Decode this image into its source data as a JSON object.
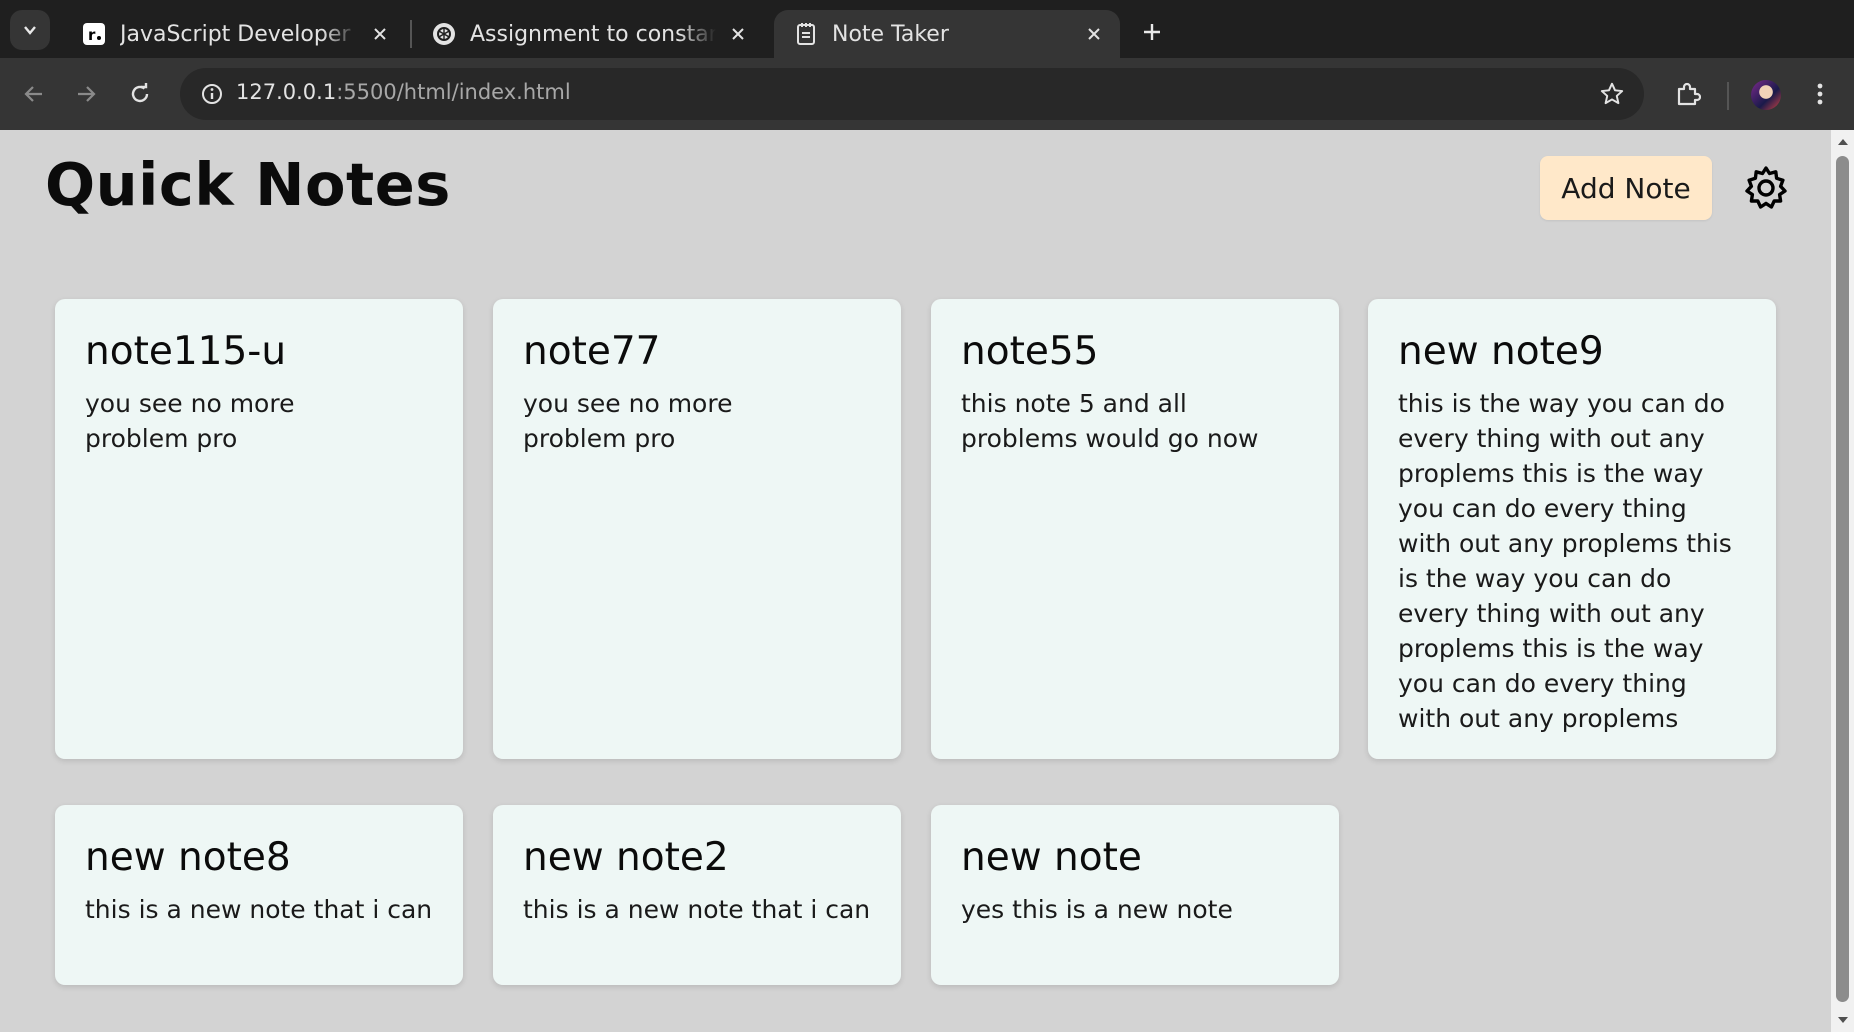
{
  "browser": {
    "tabs": [
      {
        "title": "JavaScript Developer Ro",
        "favicon": "roadmap-icon",
        "active": false
      },
      {
        "title": "Assignment to constant",
        "favicon": "openai-icon",
        "active": false
      },
      {
        "title": "Note Taker",
        "favicon": "notepad-icon",
        "active": true
      }
    ],
    "url_host": "127.0.0.1",
    "url_path": ":5500/html/index.html"
  },
  "app": {
    "title": "Quick Notes",
    "add_note_label": "Add Note",
    "settings_icon": "gear-icon"
  },
  "notes": [
    {
      "title": "note115-u",
      "body": "you see no more problem pro"
    },
    {
      "title": "note77",
      "body": "you see no more problem pro"
    },
    {
      "title": "note55",
      "body": "this note 5 and all problems would go now"
    },
    {
      "title": "new note9",
      "body": "this is the way you can do every thing with out any proplems this is the way you can do every thing with out any proplems this is the way you can do every thing with out any proplems this is the way you can do every thing with out any proplems"
    },
    {
      "title": "new note8",
      "body": "this is a new note that i can"
    },
    {
      "title": "new note2",
      "body": "this is a new note that i can"
    },
    {
      "title": "new note",
      "body": "yes this is a new note"
    }
  ],
  "colors": {
    "page_bg": "#d3d3d3",
    "card_bg": "#eef7f5",
    "add_button_bg": "#ffe8c9"
  }
}
